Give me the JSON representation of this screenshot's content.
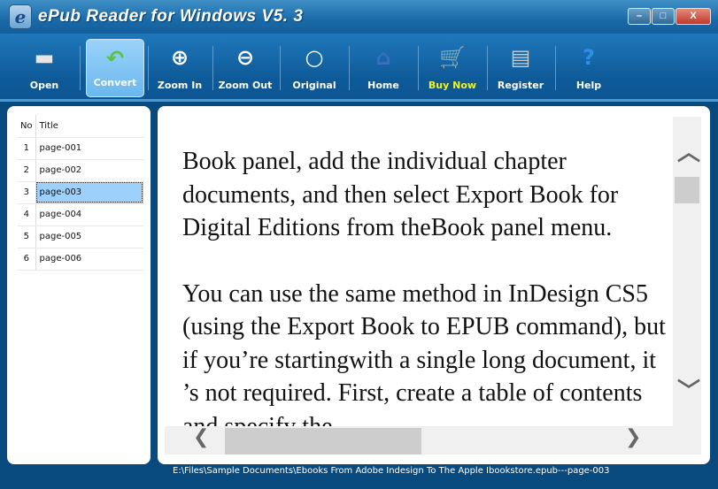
{
  "window": {
    "title": "ePub Reader for Windows V5. 3",
    "icon_letter": "e",
    "minimize": "–",
    "maximize": "□",
    "close": "X"
  },
  "toolbar": [
    {
      "label": "Open",
      "icon": "folder-icon",
      "glyph": "▬"
    },
    {
      "label": "Convert",
      "icon": "convert-arrow-icon",
      "glyph": "↶"
    },
    {
      "label": "Zoom In",
      "icon": "zoom-in-icon",
      "glyph": "⊕"
    },
    {
      "label": "Zoom Out",
      "icon": "zoom-out-icon",
      "glyph": "⊖"
    },
    {
      "label": "Original",
      "icon": "magnifier-icon",
      "glyph": "○"
    },
    {
      "label": "Home",
      "icon": "home-icon",
      "glyph": "⌂"
    },
    {
      "label": "Buy Now",
      "icon": "cart-icon",
      "glyph": "🛒"
    },
    {
      "label": "Register",
      "icon": "card-reader-icon",
      "glyph": "▤"
    },
    {
      "label": "Help",
      "icon": "help-icon",
      "glyph": "?"
    }
  ],
  "colors": {
    "buy_now": "#f4f41c",
    "accent": "#0d5592",
    "selection": "#9dd0fb"
  },
  "pages": {
    "headers": {
      "no": "No",
      "title": "Title"
    },
    "rows": [
      {
        "no": "1",
        "title": "page-001"
      },
      {
        "no": "2",
        "title": "page-002"
      },
      {
        "no": "3",
        "title": "page-003"
      },
      {
        "no": "4",
        "title": "page-004"
      },
      {
        "no": "5",
        "title": "page-005"
      },
      {
        "no": "6",
        "title": "page-006"
      }
    ],
    "selected": "3"
  },
  "content": {
    "paragraphs": [
      "Book panel, add the individual chapter documents, and then select Export Book for Digital Editions from theBook panel menu.",
      "You can use the same method in InDesign CS5 (using the Export Book to EPUB command), but if you’re startingwith a single long document, it ’s not required. First, create a table of contents and specify the"
    ]
  },
  "scroll": {
    "up": "︿",
    "down": "﹀",
    "left": "❮",
    "right": "❯"
  },
  "status": {
    "path": "E:\\Files\\Sample Documents\\Ebooks From Adobe Indesign To The Apple Ibookstore.epub---page-003"
  }
}
